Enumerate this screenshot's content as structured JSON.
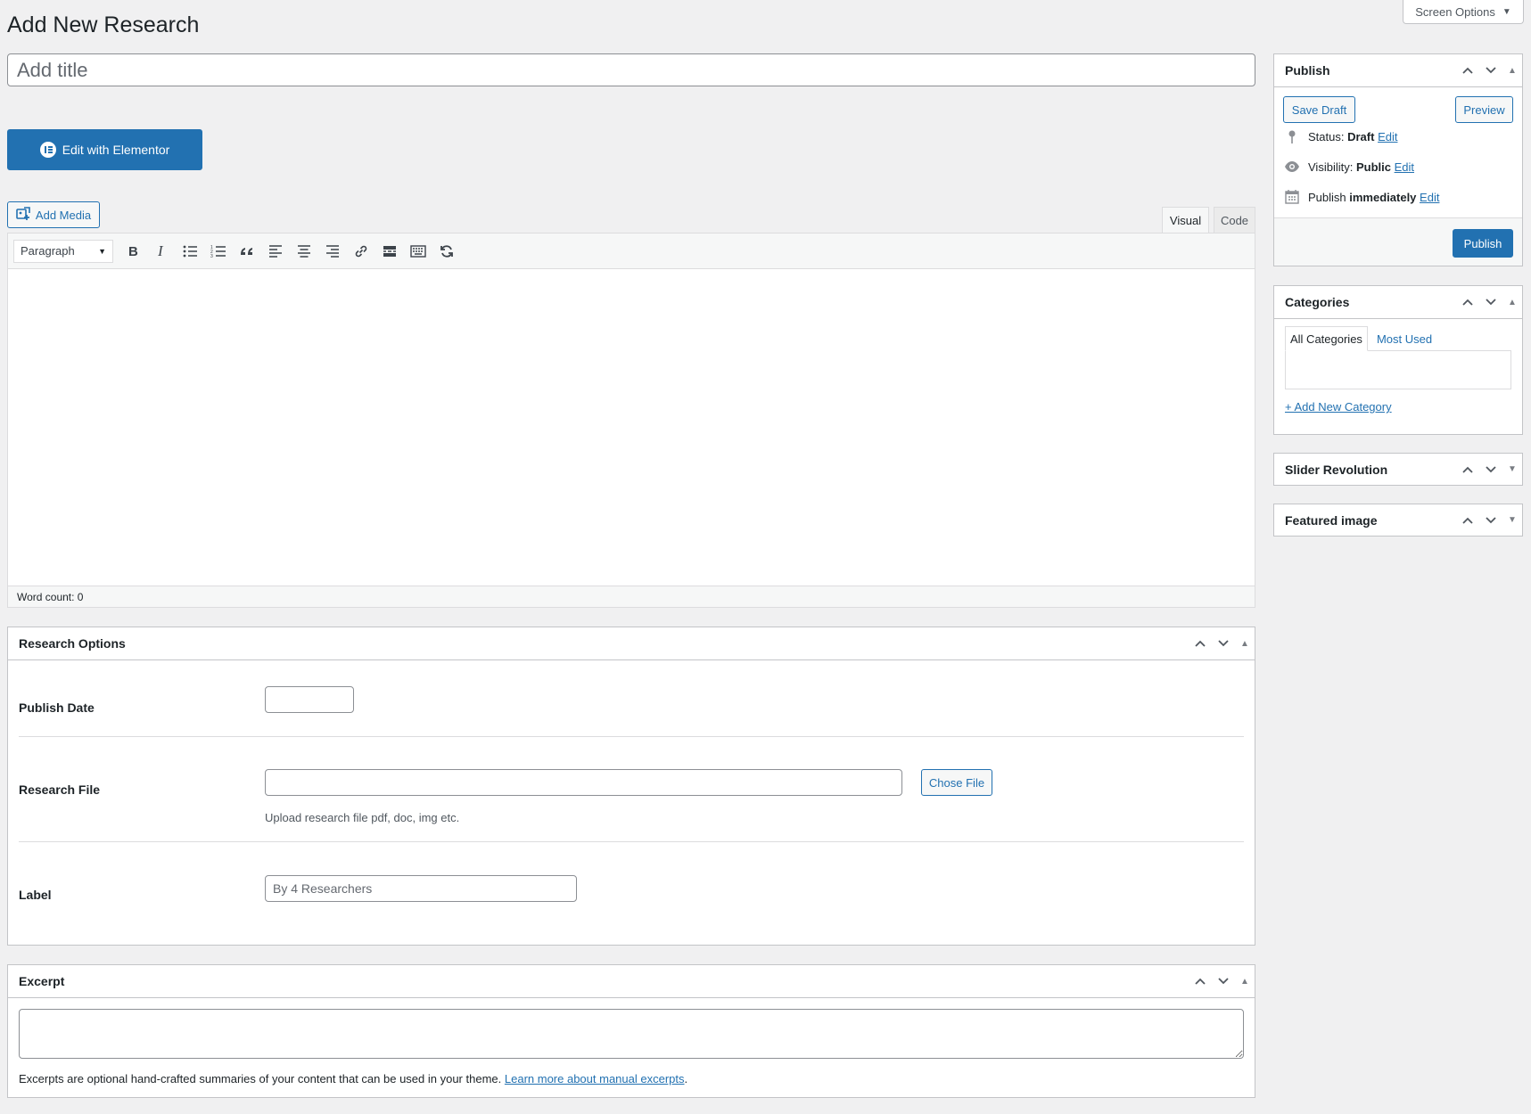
{
  "header": {
    "title": "Add New Research",
    "screen_options": "Screen Options"
  },
  "title_field": {
    "placeholder": "Add title",
    "value": ""
  },
  "elementor": {
    "label": "Edit with Elementor"
  },
  "editor": {
    "add_media": "Add Media",
    "tabs": [
      "Visual",
      "Code"
    ],
    "active_tab": "Visual",
    "format_select": "Paragraph",
    "toolbar_icons": [
      "bold-icon",
      "italic-icon",
      "bullet-list-icon",
      "numbered-list-icon",
      "blockquote-icon",
      "align-left-icon",
      "align-center-icon",
      "align-right-icon",
      "link-icon",
      "read-more-icon",
      "toolbar-toggle-icon",
      "refresh-icon"
    ],
    "word_count": "Word count: 0"
  },
  "research_options": {
    "title": "Research Options",
    "publish_date_label": "Publish Date",
    "publish_date_value": "",
    "research_file_label": "Research File",
    "research_file_value": "",
    "chose_file_button": "Chose File",
    "research_file_help": "Upload research file pdf, doc, img etc.",
    "label_label": "Label",
    "label_placeholder": "By 4 Researchers"
  },
  "excerpt": {
    "title": "Excerpt",
    "help_text": "Excerpts are optional hand-crafted summaries of your content that can be used in your theme.",
    "help_link": "Learn more about manual excerpts",
    "help_period": "."
  },
  "publish": {
    "title": "Publish",
    "save_draft": "Save Draft",
    "preview": "Preview",
    "status_label": "Status:",
    "status_value": "Draft",
    "visibility_label": "Visibility:",
    "visibility_value": "Public",
    "publish_label": "Publish",
    "publish_value": "immediately",
    "edit_link": "Edit",
    "publish_button": "Publish"
  },
  "categories": {
    "title": "Categories",
    "tab_all": "All Categories",
    "tab_most_used": "Most Used",
    "add_new": "+ Add New Category"
  },
  "slider_revolution": {
    "title": "Slider Revolution"
  },
  "featured_image": {
    "title": "Featured image"
  },
  "colors": {
    "accent": "#2271b1",
    "background": "#f0f0f1",
    "border": "#c3c4c7"
  }
}
